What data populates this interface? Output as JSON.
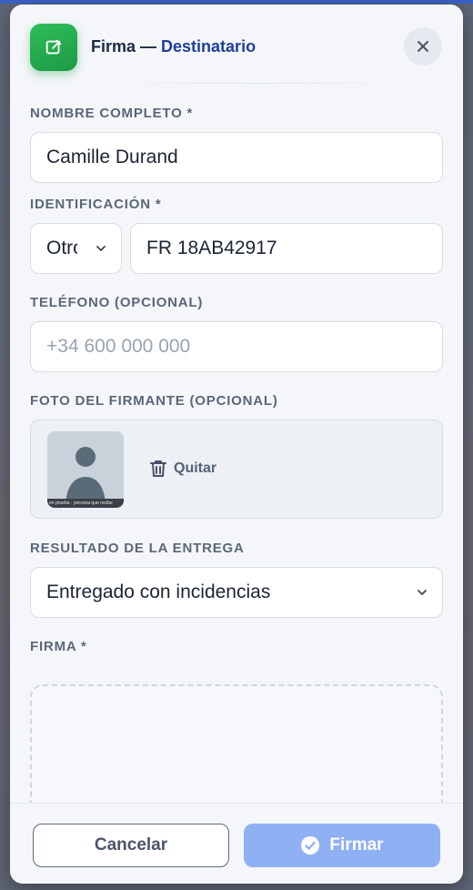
{
  "header": {
    "title_prefix": "Firma — ",
    "title_accent": "Destinatario",
    "app_icon": "edit-square-icon",
    "close_icon": "close-icon"
  },
  "form": {
    "full_name": {
      "label": "NOMBRE COMPLETO *",
      "value": "Camille Durand"
    },
    "identification": {
      "label": "IDENTIFICACIÓN *",
      "type_value": "Otro",
      "number_value": "FR 18AB42917"
    },
    "phone": {
      "label": "TELÉFONO (OPCIONAL)",
      "placeholder": "+34 600 000 000",
      "value": ""
    },
    "photo": {
      "label": "FOTO DEL FIRMANTE (OPCIONAL)",
      "thumb_caption": "en prueba · persona que recibe",
      "remove_label": "Quitar",
      "remove_icon": "trash-icon"
    },
    "delivery_result": {
      "label": "RESULTADO DE LA ENTREGA",
      "value": "Entregado con incidencias"
    },
    "signature": {
      "label": "FIRMA *"
    }
  },
  "footer": {
    "cancel_label": "Cancelar",
    "sign_label": "Firmar",
    "sign_icon": "check-circle-icon"
  },
  "colors": {
    "accent": "#1f3f9a",
    "brand_green": "#22a94e",
    "primary_disabled": "#8fb0f2"
  }
}
